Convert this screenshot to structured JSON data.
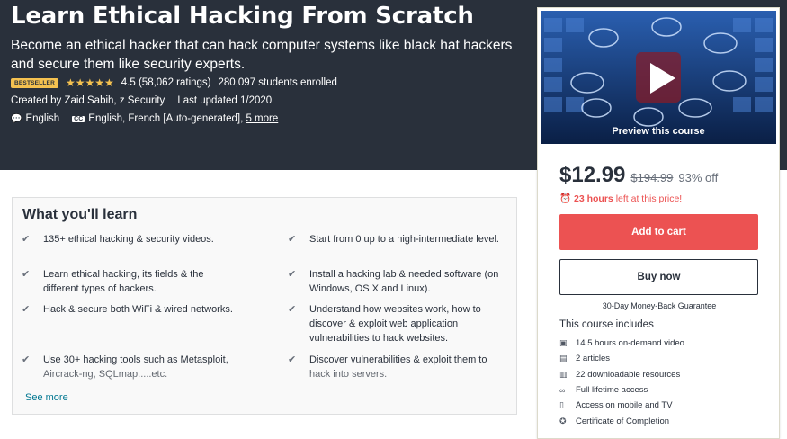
{
  "course": {
    "title": "Learn Ethical Hacking From Scratch",
    "subtitle": "Become an ethical hacker that can hack computer systems like black hat hackers and secure them like security experts.",
    "badge": "Bestseller",
    "rating": "4.5 (58,062 ratings)",
    "rating_value": 4.5,
    "enrolled": "280,097 students enrolled",
    "created_by": "Created by Zaid Sabih, z Security",
    "last_updated": "Last updated 1/2020",
    "language": "English",
    "captions": "English, French [Auto-generated],",
    "captions_more": "5 more"
  },
  "learn": {
    "title": "What you'll learn",
    "left": [
      "135+ ethical hacking & security videos.",
      "Learn ethical hacking, its fields & the different types of hackers.",
      "Hack & secure both WiFi & wired networks.",
      "Use 30+ hacking tools such as Metasploit, Aircrack-ng, SQLmap.....etc."
    ],
    "right": [
      "Start from 0 up to a high-intermediate level.",
      "Install a hacking lab & needed software (on Windows, OS X and Linux).",
      "Understand how websites work, how to discover & exploit web application vulnerabilities to hack websites.",
      "Discover vulnerabilities & exploit them to hack into servers."
    ],
    "see_more": "See more"
  },
  "sidebar": {
    "preview_label": "Preview this course",
    "price": "$12.99",
    "old_price": "$194.99",
    "discount": "93% off",
    "timer_bold": "23 hours",
    "timer_rest": "left at this price!",
    "add_to_cart": "Add to cart",
    "buy_now": "Buy now",
    "guarantee": "30-Day Money-Back Guarantee",
    "includes_title": "This course includes",
    "includes": [
      {
        "icon": "video-icon",
        "label": "14.5 hours on-demand video"
      },
      {
        "icon": "article-icon",
        "label": "2 articles"
      },
      {
        "icon": "file-icon",
        "label": "22 downloadable resources"
      },
      {
        "icon": "infinity-icon",
        "label": "Full lifetime access"
      },
      {
        "icon": "mobile-icon",
        "label": "Access on mobile and TV"
      },
      {
        "icon": "certificate-icon",
        "label": "Certificate of Completion"
      }
    ]
  },
  "colors": {
    "hero_bg": "#29303b",
    "accent_red": "#ec5252",
    "star": "#f4c150",
    "link": "#007791"
  }
}
